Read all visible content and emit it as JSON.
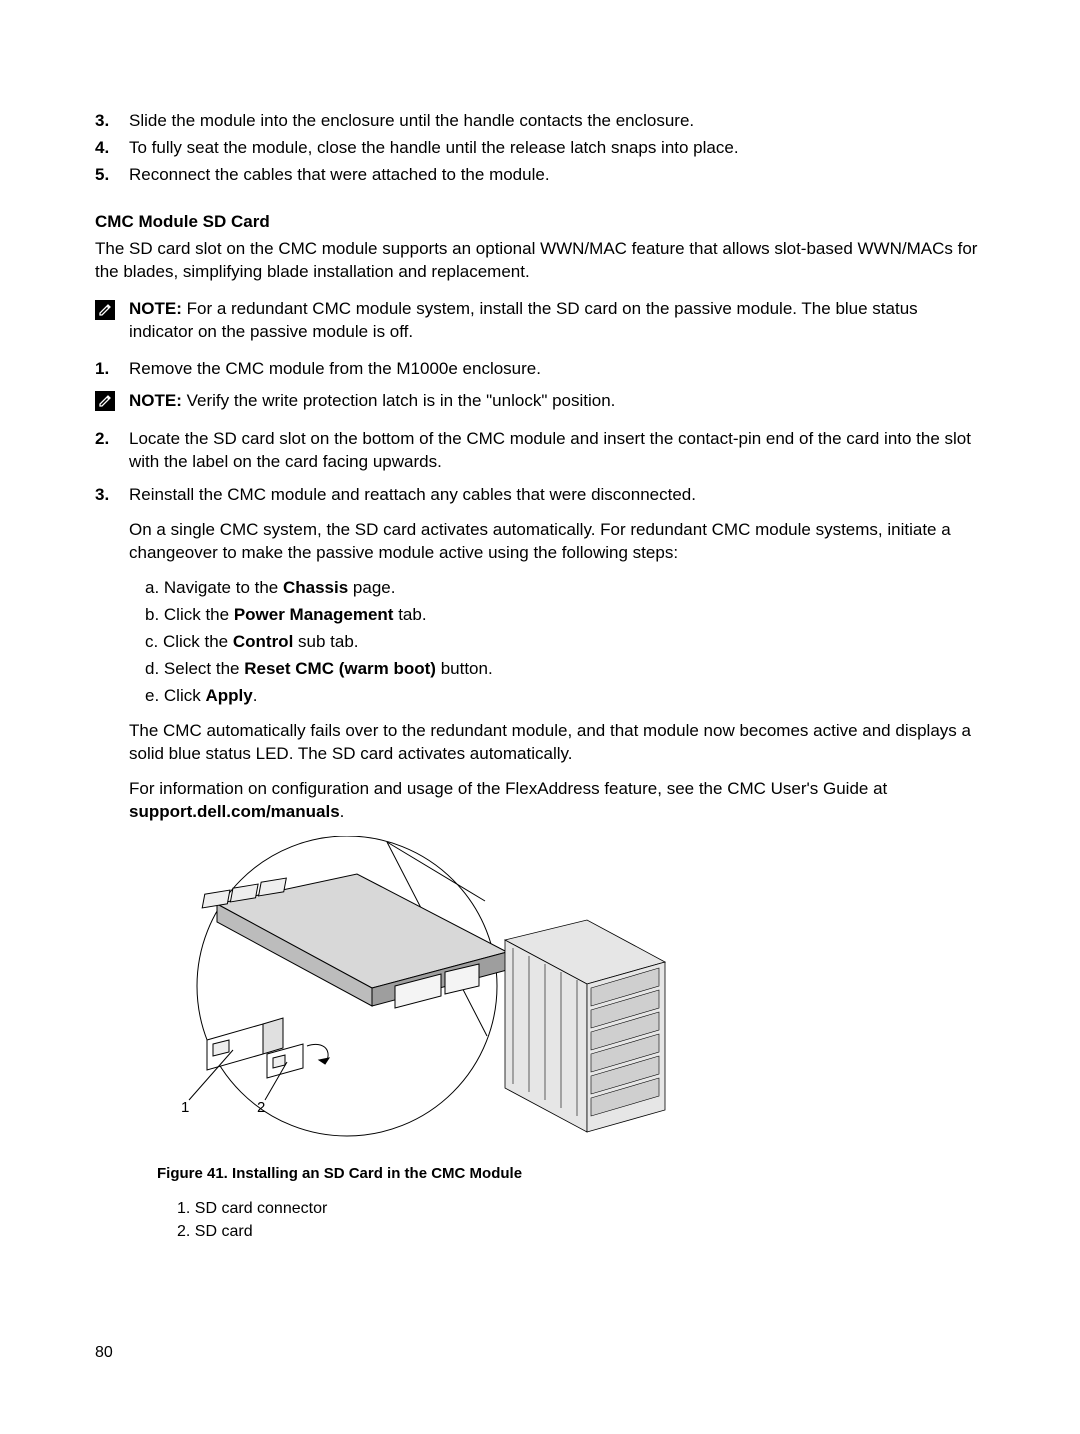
{
  "top_steps": [
    {
      "n": "3.",
      "t": "Slide the module into the enclosure until the handle contacts the enclosure."
    },
    {
      "n": "4.",
      "t": "To fully seat the module, close the handle until the release latch snaps into place."
    },
    {
      "n": "5.",
      "t": "Reconnect the cables that were attached to the module."
    }
  ],
  "section_heading": "CMC Module SD Card",
  "intro": "The SD card slot on the CMC module supports an optional WWN/MAC feature that allows slot-based WWN/MACs for the blades, simplifying blade installation and replacement.",
  "note1_label": "NOTE:",
  "note1": " For a redundant CMC module system, install the SD card on the passive module. The blue status indicator on the passive module is off.",
  "step1_n": "1.",
  "step1": "Remove the CMC module from the M1000e enclosure.",
  "note2_label": "NOTE:",
  "note2": " Verify the write protection latch is in the \"unlock\" position.",
  "step2_n": "2.",
  "step2": "Locate the SD card slot on the bottom of the CMC module and insert the contact-pin end of the card into the slot with the label on the card facing upwards.",
  "step3_n": "3.",
  "step3": "Reinstall the CMC module and reattach any cables that were disconnected.",
  "step3_p2": "On a single CMC system, the SD card activates automatically. For redundant CMC module systems, initiate a changeover to make the passive module active using the following steps:",
  "sub_a_pre": "a. Navigate to the ",
  "sub_a_b": "Chassis",
  "sub_a_post": " page.",
  "sub_b_pre": "b. Click the ",
  "sub_b_b": "Power Management",
  "sub_b_post": " tab.",
  "sub_c_pre": "c. Click the ",
  "sub_c_b": "Control",
  "sub_c_post": " sub tab.",
  "sub_d_pre": "d. Select the ",
  "sub_d_b": "Reset CMC (warm boot)",
  "sub_d_post": " button.",
  "sub_e_pre": "e. Click ",
  "sub_e_b": "Apply",
  "sub_e_post": ".",
  "tail_p1": "The CMC automatically fails over to the redundant module, and that module now becomes active and displays a solid blue status LED. The SD card activates automatically.",
  "tail_p2_pre": "For information on configuration and usage of the FlexAddress feature, see the CMC User's Guide at ",
  "tail_p2_b": "support.dell.com/manuals",
  "tail_p2_post": ".",
  "figure_caption": "Figure 41. Installing an SD Card in the CMC Module",
  "legend": [
    "1. SD card connector",
    "2. SD card"
  ],
  "callout1": "1",
  "callout2": "2",
  "page_number": "80"
}
